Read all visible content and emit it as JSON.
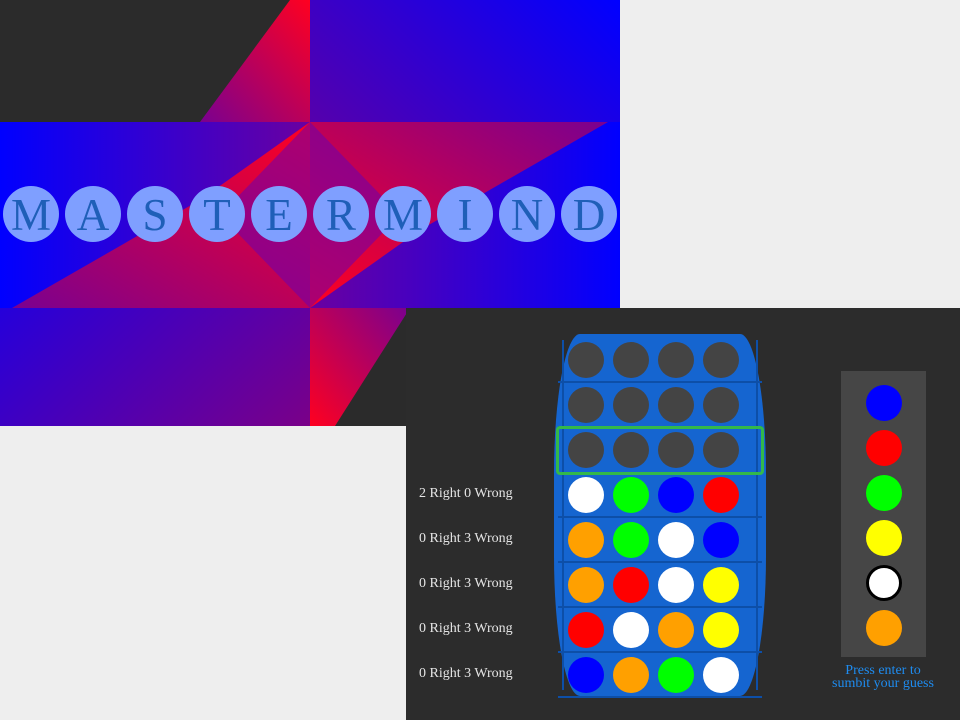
{
  "title": {
    "letters": [
      "M",
      "A",
      "S",
      "T",
      "E",
      "R",
      "M",
      "I",
      "N",
      "D"
    ]
  },
  "colors": {
    "blue": "#0000ff",
    "red": "#ff0000",
    "green": "#00ff00",
    "yellow": "#ffff00",
    "white": "#ffffff",
    "orange": "#ffa000",
    "empty": "#444444",
    "board": "#1565d0",
    "active_row_outline": "#33b84a"
  },
  "board": {
    "active_row": 3,
    "rows": [
      {
        "pegs": [
          "empty",
          "empty",
          "empty",
          "empty"
        ],
        "feedback": ""
      },
      {
        "pegs": [
          "empty",
          "empty",
          "empty",
          "empty"
        ],
        "feedback": ""
      },
      {
        "pegs": [
          "empty",
          "empty",
          "empty",
          "empty"
        ],
        "feedback": ""
      },
      {
        "pegs": [
          "white",
          "green",
          "blue",
          "red"
        ],
        "feedback": "2 Right 0 Wrong"
      },
      {
        "pegs": [
          "orange",
          "green",
          "white",
          "blue"
        ],
        "feedback": "0 Right 3 Wrong"
      },
      {
        "pegs": [
          "orange",
          "red",
          "white",
          "yellow"
        ],
        "feedback": "0 Right 3 Wrong"
      },
      {
        "pegs": [
          "red",
          "white",
          "orange",
          "yellow"
        ],
        "feedback": "0 Right 3 Wrong"
      },
      {
        "pegs": [
          "blue",
          "orange",
          "green",
          "white"
        ],
        "feedback": "0 Right 3 Wrong"
      }
    ]
  },
  "palette": {
    "swatches": [
      "blue",
      "red",
      "green",
      "yellow",
      "white",
      "orange"
    ],
    "selected": "white"
  },
  "hint": {
    "line1": "Press enter to",
    "line2": "sumbit your guess"
  }
}
